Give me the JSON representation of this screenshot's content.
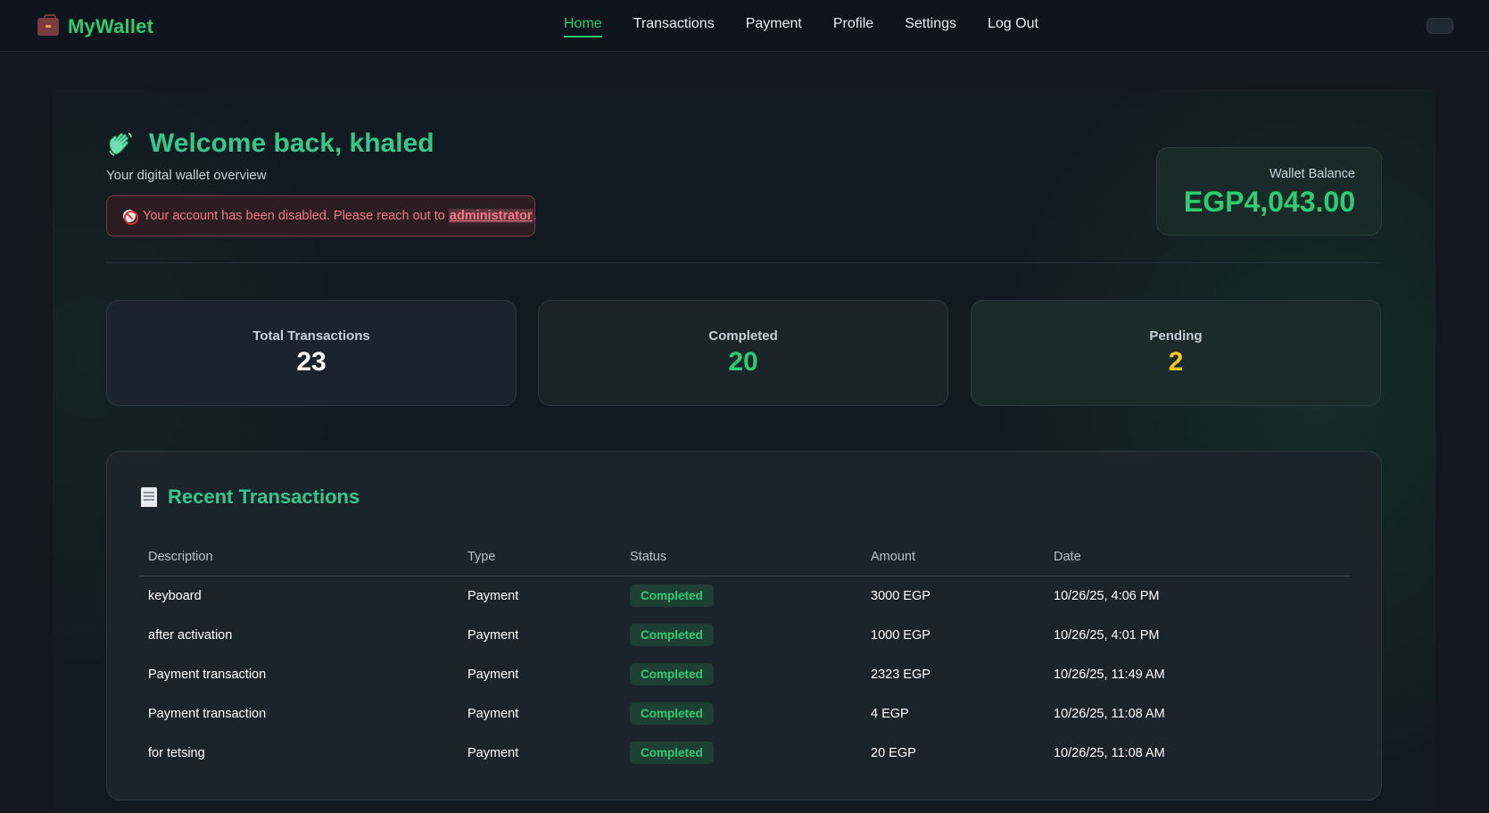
{
  "brand": {
    "name": "MyWallet",
    "icon": "briefcase-icon"
  },
  "nav": {
    "items": [
      {
        "label": "Home",
        "active": true
      },
      {
        "label": "Transactions",
        "active": false
      },
      {
        "label": "Payment",
        "active": false
      },
      {
        "label": "Profile",
        "active": false
      },
      {
        "label": "Settings",
        "active": false
      },
      {
        "label": "Log Out",
        "active": false
      }
    ]
  },
  "welcome": {
    "title": "Welcome back, khaled",
    "subtitle": "Your digital wallet overview",
    "icon": "waving-hand-icon"
  },
  "alert": {
    "text": "Your account has been disabled. Please reach out to ",
    "link": "administrator",
    "suffix": "."
  },
  "balance": {
    "label": "Wallet Balance",
    "value": "EGP4,043.00"
  },
  "stats": [
    {
      "label": "Total Transactions",
      "value": "23",
      "color": "#ffffff"
    },
    {
      "label": "Completed",
      "value": "20",
      "color": "#2ecc71"
    },
    {
      "label": "Pending",
      "value": "2",
      "color": "#f5c518"
    }
  ],
  "transactions": {
    "title": "Recent Transactions",
    "columns": [
      "Description",
      "Type",
      "Status",
      "Amount",
      "Date"
    ],
    "rows": [
      {
        "description": "keyboard",
        "type": "Payment",
        "status": "Completed",
        "amount": "3000 EGP",
        "date": "10/26/25, 4:06 PM"
      },
      {
        "description": "after activation",
        "type": "Payment",
        "status": "Completed",
        "amount": "1000 EGP",
        "date": "10/26/25, 4:01 PM"
      },
      {
        "description": "Payment transaction",
        "type": "Payment",
        "status": "Completed",
        "amount": "2323 EGP",
        "date": "10/26/25, 11:49 AM"
      },
      {
        "description": "Payment transaction",
        "type": "Payment",
        "status": "Completed",
        "amount": "4 EGP",
        "date": "10/26/25, 11:08 AM"
      },
      {
        "description": "for tetsing",
        "type": "Payment",
        "status": "Completed",
        "amount": "20 EGP",
        "date": "10/26/25, 11:08 AM"
      }
    ]
  },
  "colors": {
    "accent": "#2ecc71",
    "pending": "#f5c518",
    "alert": "#f07b84"
  }
}
